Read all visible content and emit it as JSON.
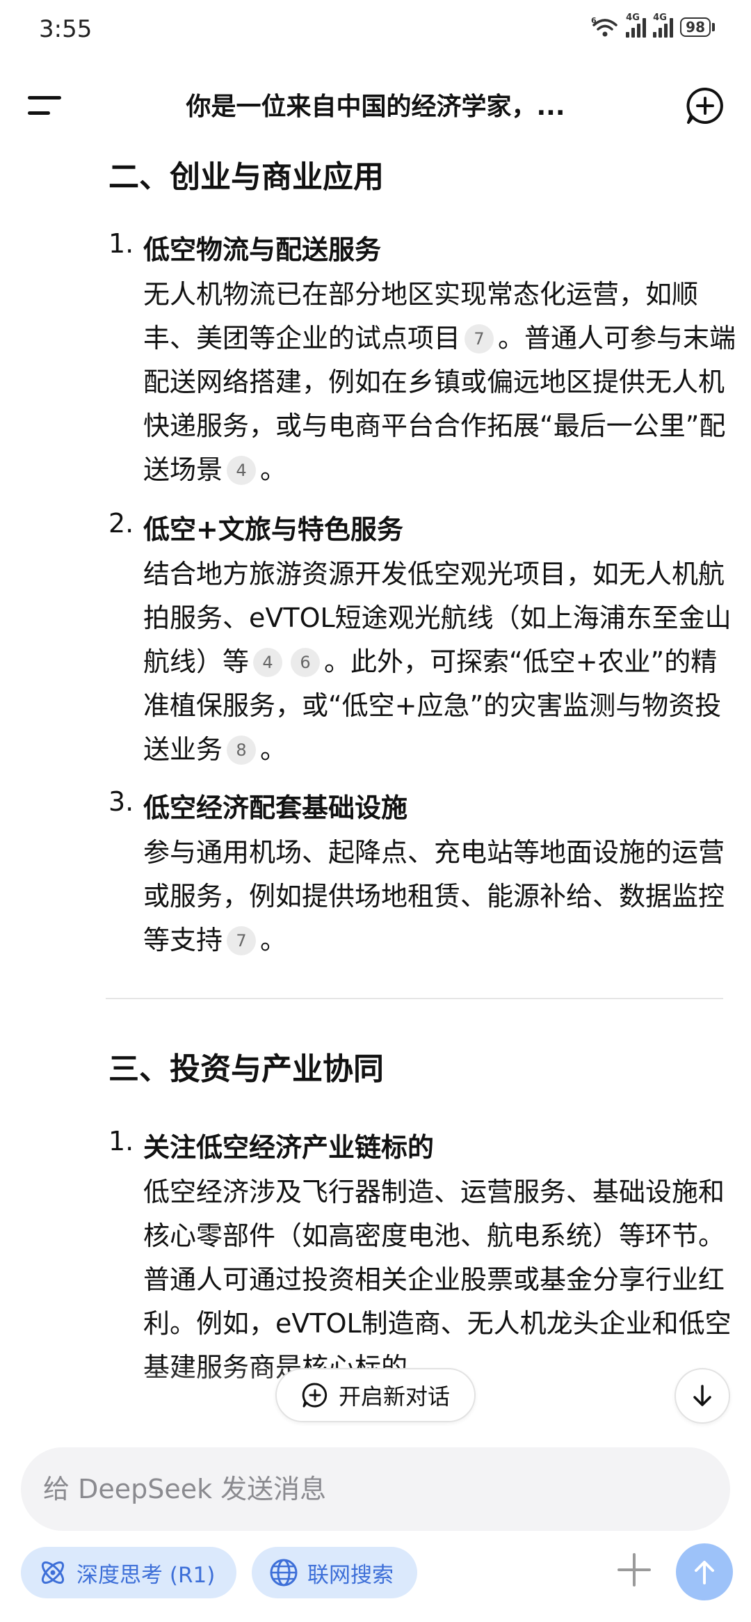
{
  "status_bar": {
    "time": "3:55",
    "battery": "98",
    "network_1": "4G",
    "network_2": "4G",
    "wifi": "6"
  },
  "header": {
    "title": "你是一位来自中国的经济学家，..."
  },
  "content": {
    "section_2": {
      "heading": "二、创业与商业应用",
      "items": [
        {
          "num": "1.",
          "title": "低空物流与配送服务",
          "body": [
            {
              "t": "text",
              "v": "无人机物流已在部分地区实现常态化运营，如顺丰、美团等企业的试点项目"
            },
            {
              "t": "cite",
              "v": "7"
            },
            {
              "t": "text",
              "v": "。普通人可参与末端配送网络搭建，例如在乡镇或偏远地区提供无人机快递服务，或与电商平台合作拓展“最后一公里”配送场景"
            },
            {
              "t": "cite",
              "v": "4"
            },
            {
              "t": "text",
              "v": "。"
            }
          ]
        },
        {
          "num": "2.",
          "title": "低空+文旅与特色服务",
          "body": [
            {
              "t": "text",
              "v": "结合地方旅游资源开发低空观光项目，如无人机航拍服务、eVTOL短途观光航线（如上海浦东至金山航线）等"
            },
            {
              "t": "cite",
              "v": "4"
            },
            {
              "t": "cite",
              "v": "6"
            },
            {
              "t": "text",
              "v": "。此外，可探索“低空+农业”的精准植保服务，或“低空+应急”的灾害监测与物资投送业务"
            },
            {
              "t": "cite",
              "v": "8"
            },
            {
              "t": "text",
              "v": "。"
            }
          ]
        },
        {
          "num": "3.",
          "title": "低空经济配套基础设施",
          "body": [
            {
              "t": "text",
              "v": "参与通用机场、起降点、充电站等地面设施的运营或服务，例如提供场地租赁、能源补给、数据监控等支持"
            },
            {
              "t": "cite",
              "v": "7"
            },
            {
              "t": "text",
              "v": "。"
            }
          ]
        }
      ]
    },
    "section_3": {
      "heading": "三、投资与产业协同",
      "items": [
        {
          "num": "1.",
          "title": "关注低空经济产业链标的",
          "body": [
            {
              "t": "text",
              "v": "低空经济涉及飞行器制造、运营服务、基础设施和核心零部件（如高密度电池、航电系统）等环节。普通人可通过投资相关企业股票或基金分享行业红利。例如，eVTOL制造商、无人机龙头企业和低空基建服务商是核心标的"
            }
          ]
        }
      ]
    }
  },
  "floating": {
    "new_dialog_label": "开启新对话"
  },
  "input": {
    "placeholder": "给 DeepSeek 发送消息"
  },
  "toolbar": {
    "deep_think_label": "深度思考 (R1)",
    "web_search_label": "联网搜索"
  },
  "colors": {
    "accent": "#3d6fd8",
    "chip_bg": "#dbe9fc",
    "send_bg": "#9dc2f9"
  }
}
